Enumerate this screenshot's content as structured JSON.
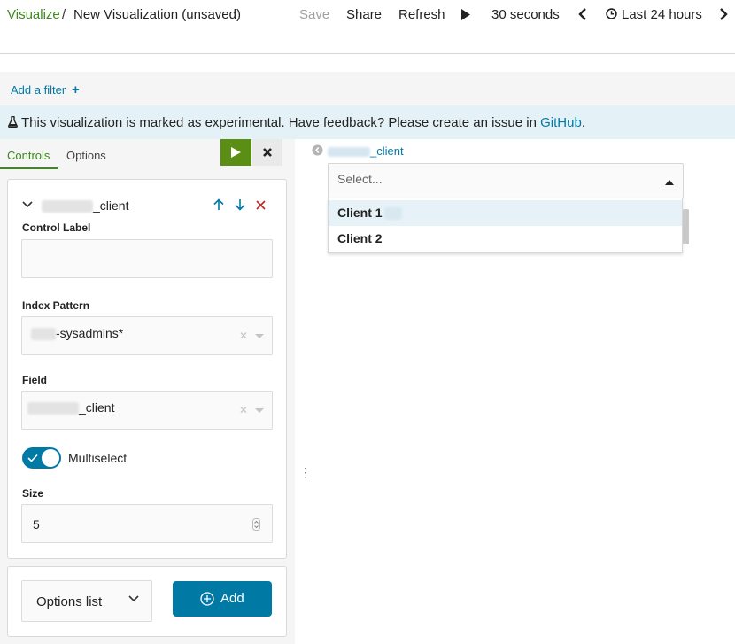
{
  "header": {
    "breadcrumb_root": "Visualize",
    "breadcrumb_sep": "/",
    "breadcrumb_current": "New Visualization (unsaved)",
    "save_label": "Save",
    "share_label": "Share",
    "refresh_label": "Refresh",
    "refresh_interval": "30 seconds",
    "time_range": "Last 24 hours"
  },
  "filter": {
    "add_label": "Add a filter"
  },
  "banner": {
    "text": "This visualization is marked as experimental. Have feedback? Please create an issue in ",
    "link": "GitHub",
    "suffix": "."
  },
  "editor": {
    "tabs": [
      "Controls",
      "Options"
    ],
    "control": {
      "title_suffix": "_client",
      "control_label_label": "Control Label",
      "control_label_value": "",
      "index_pattern_label": "Index Pattern",
      "index_pattern_value": "-sysadmins*",
      "field_label": "Field",
      "field_value": "_client",
      "multiselect_label": "Multiselect",
      "multiselect_on": true,
      "size_label": "Size",
      "size_value": "5"
    },
    "add_control": {
      "type_label": "Options list",
      "add_label": "Add"
    }
  },
  "visualization": {
    "control_label": "_client",
    "placeholder": "Select...",
    "options": [
      "Client 1",
      "Client 2"
    ]
  },
  "colors": {
    "accent_green": "#3b8a1c",
    "link_blue": "#0079a5",
    "banner_bg": "#e4f1f6"
  }
}
